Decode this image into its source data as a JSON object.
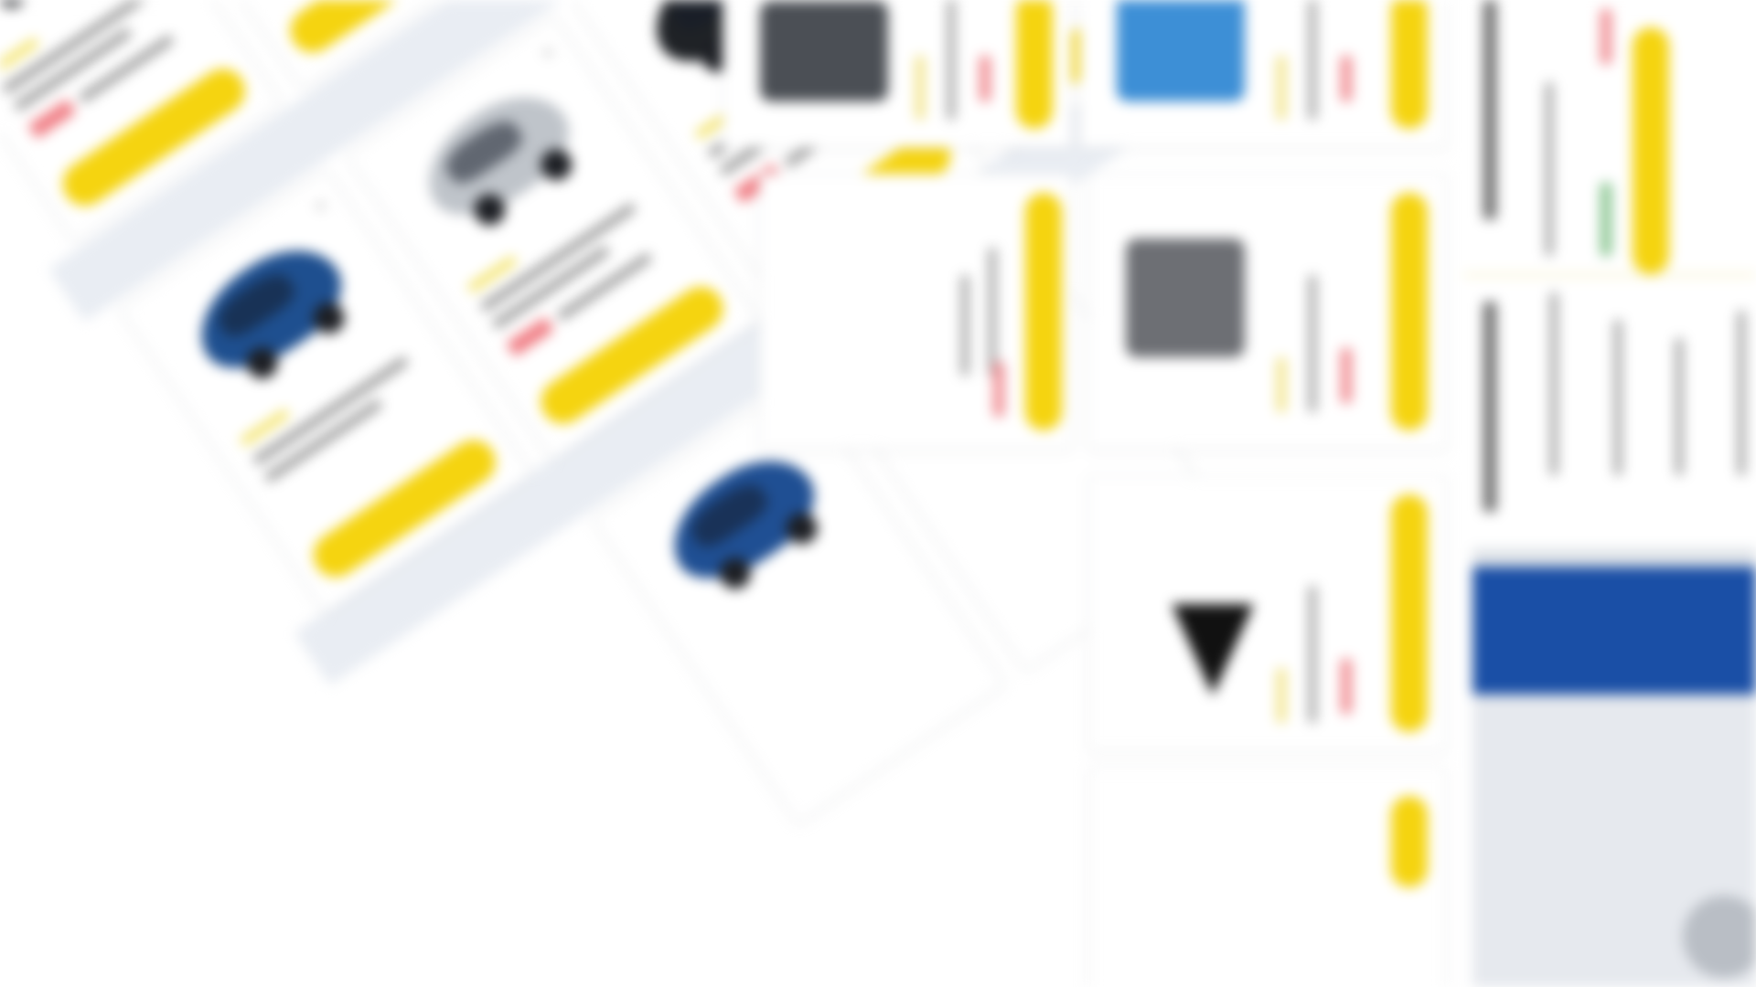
{
  "page": {
    "background": "#ffffff",
    "accent_yellow": "#f5d410",
    "strip_color": "#e9edf3",
    "badge_red": "#f07f86"
  },
  "rotated_cards": [
    {
      "car_color": "#c9202a",
      "icon": "car-red-icon"
    },
    {
      "car_color": "#1f4f93",
      "icon": "car-blue-icon"
    },
    {
      "car_color": "#1f2226",
      "icon": "car-black-icon"
    },
    {
      "car_color": "#bfc4ca",
      "icon": "car-silver-icon"
    },
    {
      "car_color": "#c9202a",
      "icon": "car-red-icon"
    },
    {
      "car_color": "#1e4f8f",
      "icon": "car-blue-icon"
    }
  ],
  "right_columns": {
    "thumb_colors": [
      "#4b4f55",
      "#3d8fd6",
      "#6d6f74",
      "#111111"
    ]
  },
  "side_panel": {
    "photo_colors": [
      "#1a4fa6",
      "#e6e9ee",
      "#b9bec5"
    ]
  }
}
